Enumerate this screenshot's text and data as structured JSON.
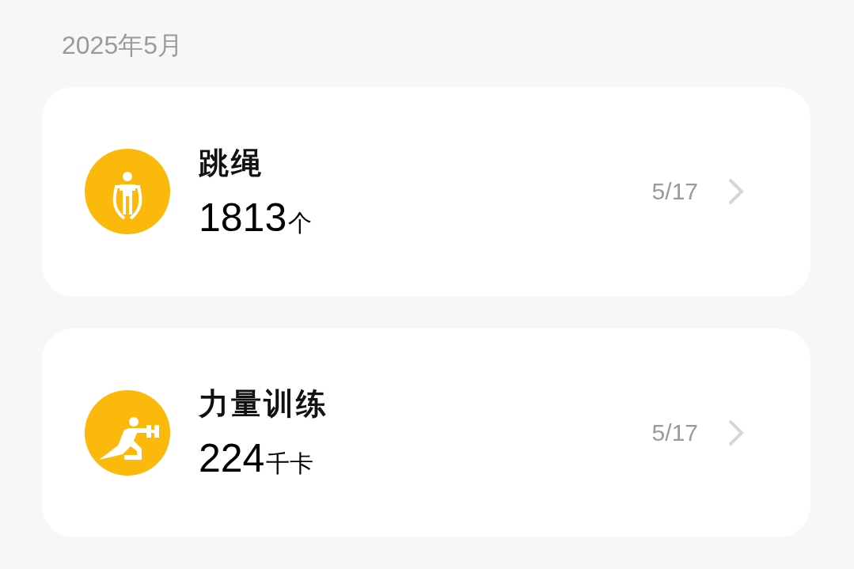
{
  "month": "2025年5月",
  "records": [
    {
      "kind": "jump-rope",
      "title": "跳绳",
      "value": "1813",
      "unit": "个",
      "date": "5/17"
    },
    {
      "kind": "strength",
      "title": "力量训练",
      "value": "224",
      "unit": "千卡",
      "date": "5/17"
    }
  ]
}
